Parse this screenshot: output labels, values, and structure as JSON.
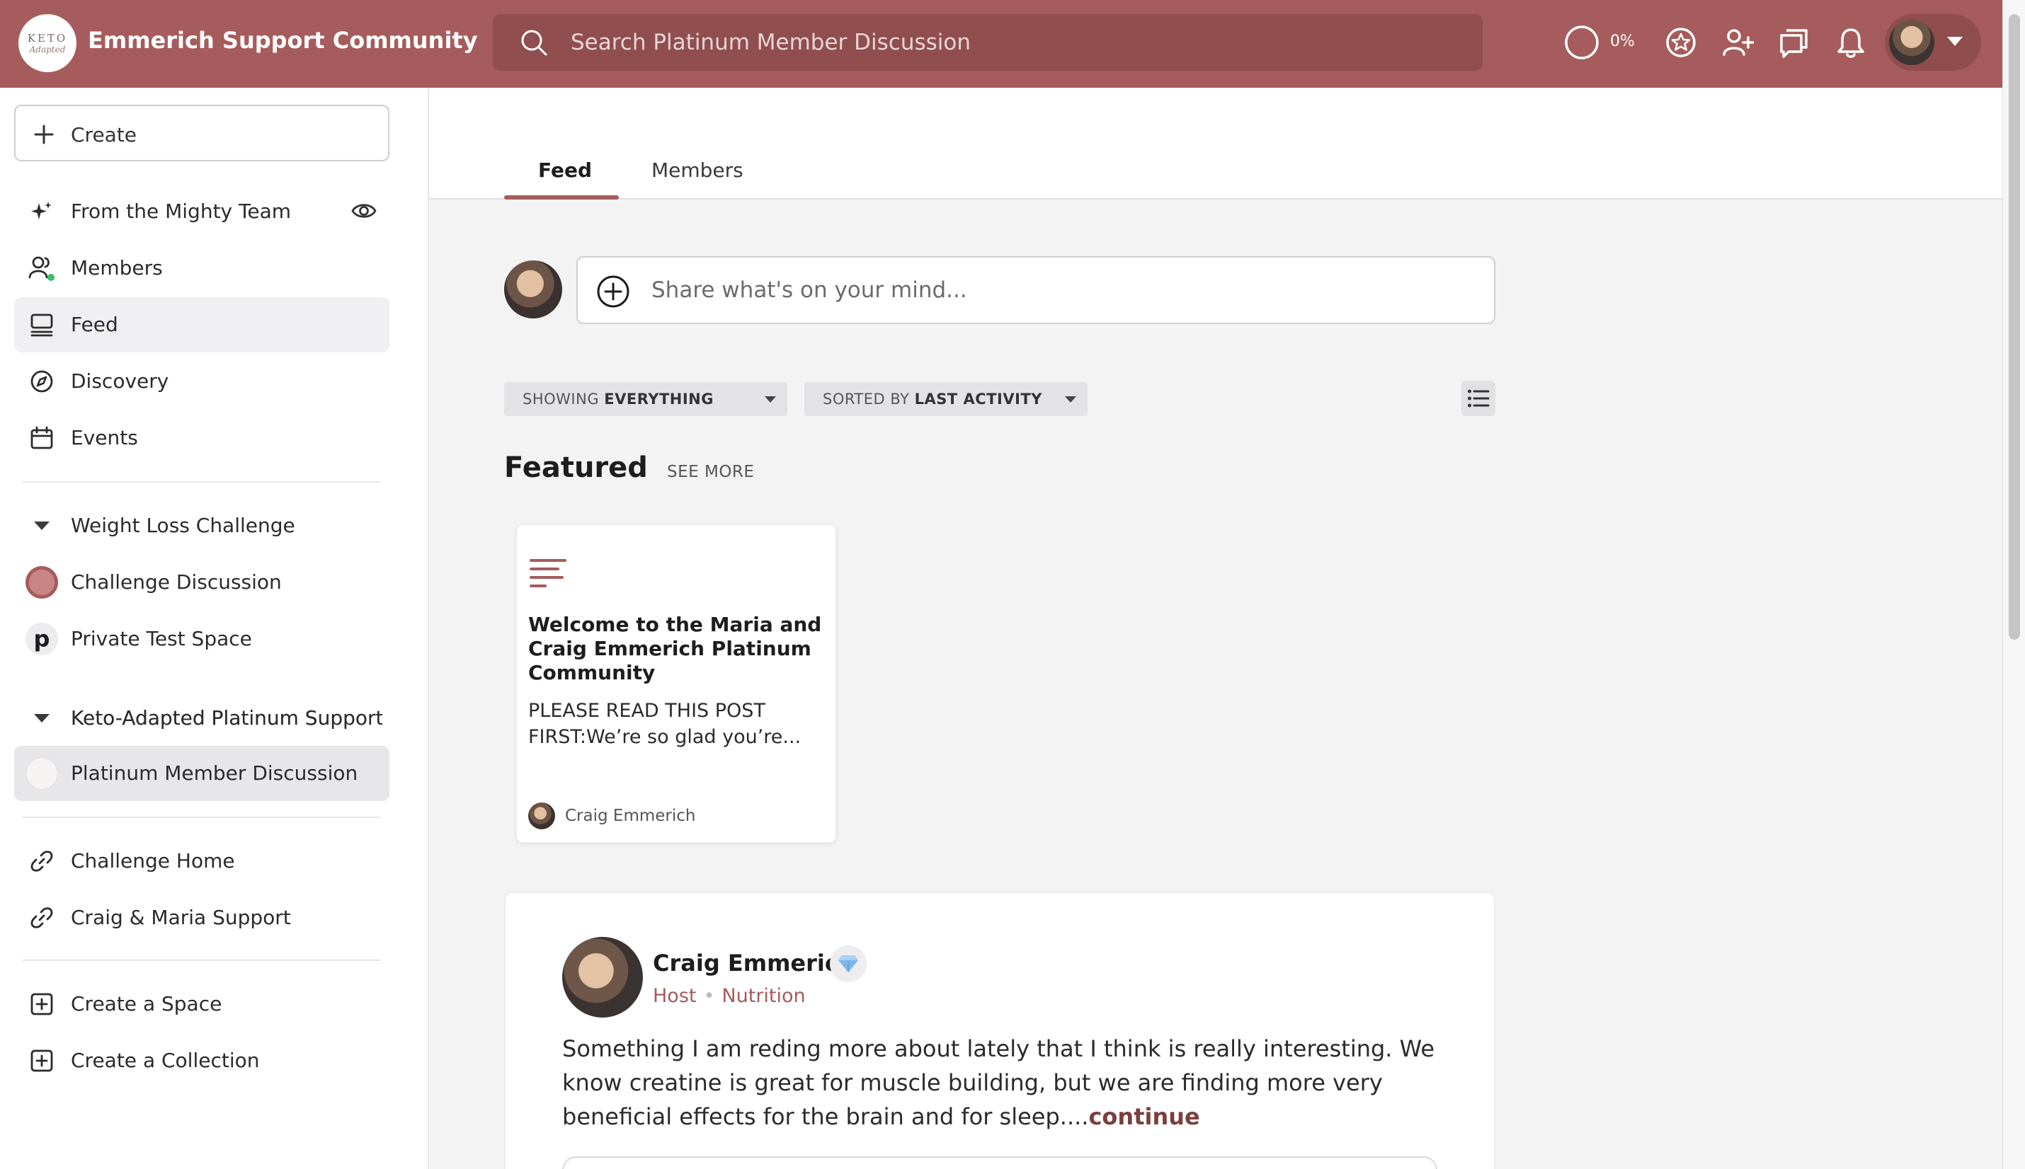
{
  "header": {
    "community_name": "Emmerich Support Community",
    "logo_top": "KETO",
    "logo_bottom": "Adapted",
    "search_placeholder": "Search Platinum Member Discussion",
    "progress": "0%",
    "accent_color": "#a65c5c"
  },
  "sidebar": {
    "create_label": "Create",
    "items": [
      {
        "label": "From the Mighty Team",
        "icon": "sparkles-icon"
      },
      {
        "label": "Members",
        "icon": "people-icon"
      },
      {
        "label": "Feed",
        "icon": "feed-icon",
        "active": true
      },
      {
        "label": "Discovery",
        "icon": "compass-icon"
      },
      {
        "label": "Events",
        "icon": "calendar-icon"
      }
    ],
    "group1": {
      "title": "Weight Loss Challenge",
      "spaces": [
        {
          "label": "Challenge Discussion"
        },
        {
          "label": "Private Test Space",
          "initial": "p"
        }
      ]
    },
    "group2": {
      "title": "Keto-Adapted Platinum Support",
      "spaces": [
        {
          "label": "Platinum Member Discussion",
          "active": true
        }
      ]
    },
    "links": [
      {
        "label": "Challenge Home"
      },
      {
        "label": "Craig & Maria Support"
      }
    ],
    "actions": [
      {
        "label": "Create a Space"
      },
      {
        "label": "Create a Collection"
      }
    ]
  },
  "main": {
    "tabs": [
      {
        "label": "Feed",
        "active": true
      },
      {
        "label": "Members"
      }
    ],
    "composer_placeholder": "Share what's on your mind...",
    "filters": {
      "showing_prefix": "SHOWING",
      "showing_value": "EVERYTHING",
      "sorted_prefix": "SORTED BY",
      "sorted_value": "LAST ACTIVITY"
    },
    "featured": {
      "title": "Featured",
      "see_more": "SEE MORE",
      "card": {
        "title": "Welcome to the Maria and Craig Emmerich Platinum Community",
        "excerpt": "PLEASE READ THIS POST FIRST:We’re so glad you’re...",
        "author": "Craig Emmerich"
      }
    },
    "post": {
      "author": "Craig Emmerich",
      "role": "Host",
      "tag": "Nutrition",
      "body": "Something I am reding more about lately that I think is really interesting. We know creatine is great for muscle building, but we are finding more very beneficial effects for the brain and for sleep....",
      "continue": "continue"
    }
  }
}
